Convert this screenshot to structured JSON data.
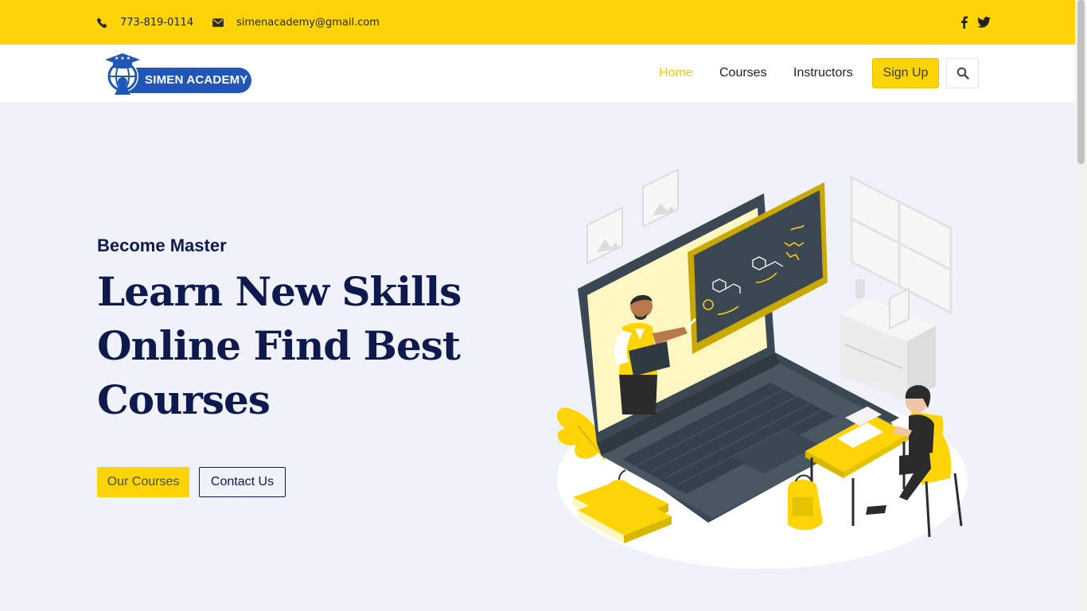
{
  "topbar": {
    "phone": "773-819-0114",
    "email": "simenacademy@gmail.com",
    "phone_icon": "phone-icon",
    "email_icon": "envelope-icon",
    "social": [
      "facebook-icon",
      "twitter-icon"
    ]
  },
  "brand": {
    "logo_text": "SIMEN ACADEMY"
  },
  "nav": {
    "items": [
      {
        "label": "Home",
        "active": true
      },
      {
        "label": "Courses"
      },
      {
        "label": "Instructors"
      }
    ],
    "signup_label": "Sign Up",
    "search_icon": "search-icon"
  },
  "hero": {
    "subtitle": "Become Master",
    "headline": "Learn New Skills Online Find Best Courses",
    "primary_button": "Our Courses",
    "secondary_button": "Contact Us"
  },
  "colors": {
    "accent": "#fdd506",
    "navy": "#0e1a4d",
    "background": "#f0f2fa",
    "logo_blue": "#1f56b8"
  }
}
